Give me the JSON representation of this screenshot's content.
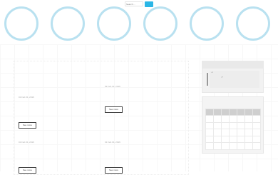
{
  "search": {
    "placeholder": "Search ..."
  },
  "circles": {
    "count": 6,
    "ring_color": "#b9e1f0"
  },
  "accent_color": "#2bb6e6",
  "posts": [
    {
      "date": "01 Feb 01, 2016",
      "see_more": "See more"
    },
    {
      "date": "09 Feb 01, 2016",
      "see_more": "See more"
    },
    {
      "date": "01 Feb 01, 2016",
      "see_more": "See more"
    },
    {
      "date": "01 Feb 01, 2016",
      "see_more": "See more"
    }
  ],
  "quote_widget": {
    "open_mark": "“",
    "close_mark": "”"
  }
}
